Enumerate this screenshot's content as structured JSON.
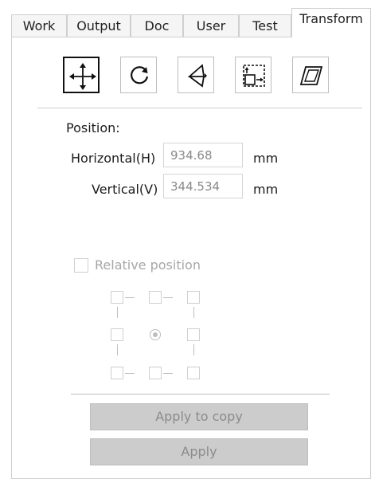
{
  "tabs": [
    {
      "label": "Work"
    },
    {
      "label": "Output"
    },
    {
      "label": "Doc"
    },
    {
      "label": "User"
    },
    {
      "label": "Test"
    },
    {
      "label": "Transform",
      "active": true
    }
  ],
  "toolbar": {
    "tools": [
      {
        "name": "move-tool",
        "icon": "move-arrows-icon",
        "active": true
      },
      {
        "name": "rotate-tool",
        "icon": "rotate-icon",
        "active": false
      },
      {
        "name": "mirror-tool",
        "icon": "mirror-icon",
        "active": false
      },
      {
        "name": "scale-tool",
        "icon": "scale-icon",
        "active": false
      },
      {
        "name": "skew-tool",
        "icon": "skew-icon",
        "active": false
      }
    ]
  },
  "position": {
    "title": "Position:",
    "horizontal_label": "Horizontal(H)",
    "horizontal_value": "934.68",
    "vertical_label": "Vertical(V)",
    "vertical_value": "344.534",
    "unit": "mm"
  },
  "relative": {
    "label": "Relative position",
    "checked": false
  },
  "buttons": {
    "apply_to_copy": "Apply to copy",
    "apply": "Apply"
  }
}
